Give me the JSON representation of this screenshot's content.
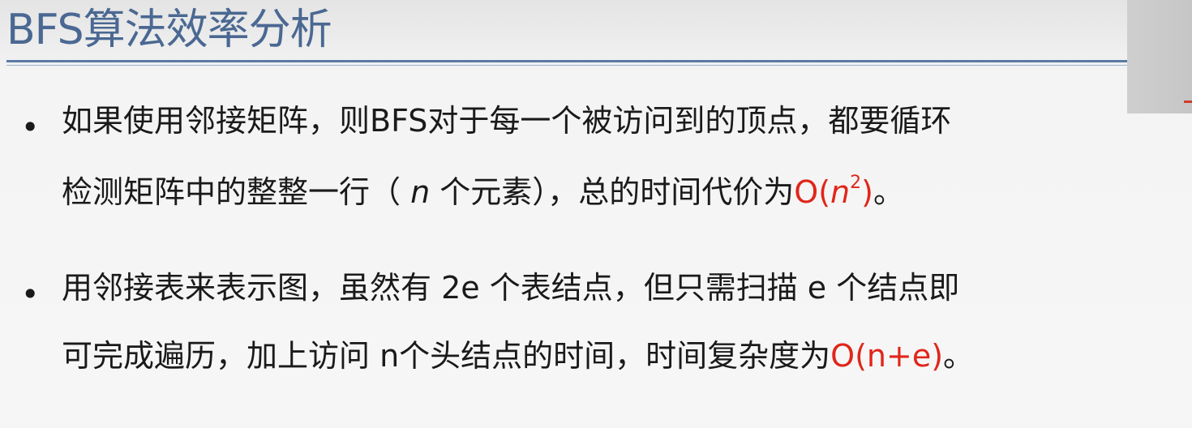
{
  "title": "BFS算法效率分析",
  "bullets": [
    {
      "marker": "•",
      "line1": "如果使用邻接矩阵，则BFS对于每一个被访问到的顶点，都要循环",
      "line2_prefix": "检测矩阵中的整整一行（ ",
      "line2_var": "n",
      "line2_mid": " 个元素），总的时间代价为",
      "line2_formula_open": "O(",
      "line2_formula_var": "n",
      "line2_formula_exp": "2",
      "line2_formula_close": ")",
      "line2_suffix": "。"
    },
    {
      "marker": "•",
      "line1": "用邻接表来表示图，虽然有 2e 个表结点，但只需扫描 e 个结点即",
      "line2_prefix": "可完成遍历，加上访问 n个头结点的时间，时间复杂度为",
      "line2_formula": "O(n+e)",
      "line2_suffix": "。"
    }
  ],
  "colors": {
    "title": "#4a6892",
    "rule": "#5a7aa5",
    "text": "#1a1a1a",
    "highlight": "#e0261a",
    "background": "#f4f4f4"
  }
}
